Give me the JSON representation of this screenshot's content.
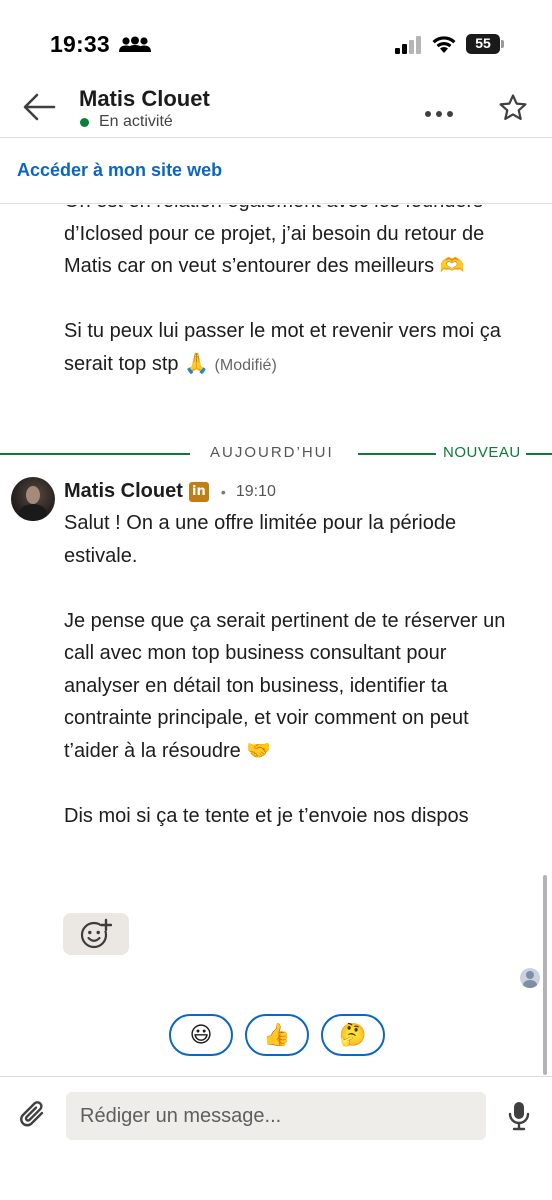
{
  "status_bar": {
    "time": "19:33",
    "battery": "55"
  },
  "header": {
    "contact_name": "Matis Clouet",
    "presence": "En activité"
  },
  "site_link": {
    "label": "Accéder à mon site web"
  },
  "previous_message": {
    "paragraph_1": "On est en relation également avec les founders d’Iclosed pour ce projet, j’ai besoin du retour de Matis car on veut s’entourer des meilleurs 🫶",
    "paragraph_2": "Si tu peux lui passer le mot et revenir vers moi ça serait top stp 🙏",
    "modified_label": "(Modifié)"
  },
  "divider": {
    "label": "AUJOURD’HUI",
    "new_label": "NOUVEAU"
  },
  "new_message": {
    "sender": "Matis Clouet",
    "badge": "in",
    "separator": "•",
    "time": "19:10",
    "paragraph_1": "Salut ! On a une offre limitée pour la période estivale.",
    "paragraph_2": "Je pense que ça serait pertinent de te réserver un call avec mon top business consultant pour analyser en détail ton business, identifier ta contrainte principale, et voir comment on peut t’aider à la résoudre 🤝",
    "paragraph_3": "Dis moi si ça te tente et je t’envoie nos dispos"
  },
  "quick_reactions": [
    "😃",
    "👍",
    "🤔"
  ],
  "composer": {
    "placeholder": "Rédiger un message..."
  },
  "colors": {
    "link_blue": "#0a66c2",
    "presence_green": "#0a7e3a",
    "divider_green": "#0b7a3b",
    "linkedin_badge": "#c37d16"
  },
  "icons": [
    "people-icon",
    "signal-icon",
    "wifi-icon",
    "battery-icon",
    "back-arrow-icon",
    "more-icon",
    "star-icon",
    "add-reaction-icon",
    "paperclip-icon",
    "microphone-icon"
  ]
}
